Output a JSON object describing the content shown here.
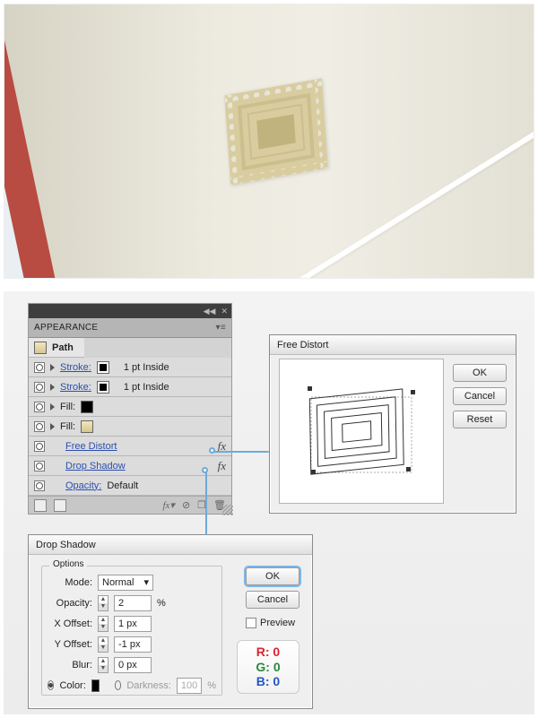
{
  "appearance": {
    "title": "APPEARANCE",
    "target": "Path",
    "rows": {
      "stroke1": {
        "label": "Stroke:",
        "meta": "1 pt  Inside"
      },
      "stroke2": {
        "label": "Stroke:",
        "meta": "1 pt  Inside"
      },
      "fill1": {
        "label": "Fill:"
      },
      "fill2": {
        "label": "Fill:"
      },
      "fx1": {
        "label": "Free Distort"
      },
      "fx2": {
        "label": "Drop Shadow"
      },
      "opacity": {
        "label": "Opacity:",
        "value": "Default"
      }
    }
  },
  "free_distort": {
    "title": "Free Distort",
    "buttons": {
      "ok": "OK",
      "cancel": "Cancel",
      "reset": "Reset"
    }
  },
  "drop_shadow": {
    "title": "Drop Shadow",
    "group": "Options",
    "mode_label": "Mode:",
    "mode_value": "Normal",
    "opacity_label": "Opacity:",
    "opacity_value": "2",
    "pct": "%",
    "xoff_label": "X Offset:",
    "xoff_value": "1 px",
    "yoff_label": "Y Offset:",
    "yoff_value": "-1 px",
    "blur_label": "Blur:",
    "blur_value": "0 px",
    "color_label": "Color:",
    "darkness_label": "Darkness:",
    "darkness_value": "100",
    "buttons": {
      "ok": "OK",
      "cancel": "Cancel"
    },
    "preview": "Preview",
    "rgb": {
      "r": "R: 0",
      "g": "G: 0",
      "b": "B: 0"
    }
  }
}
